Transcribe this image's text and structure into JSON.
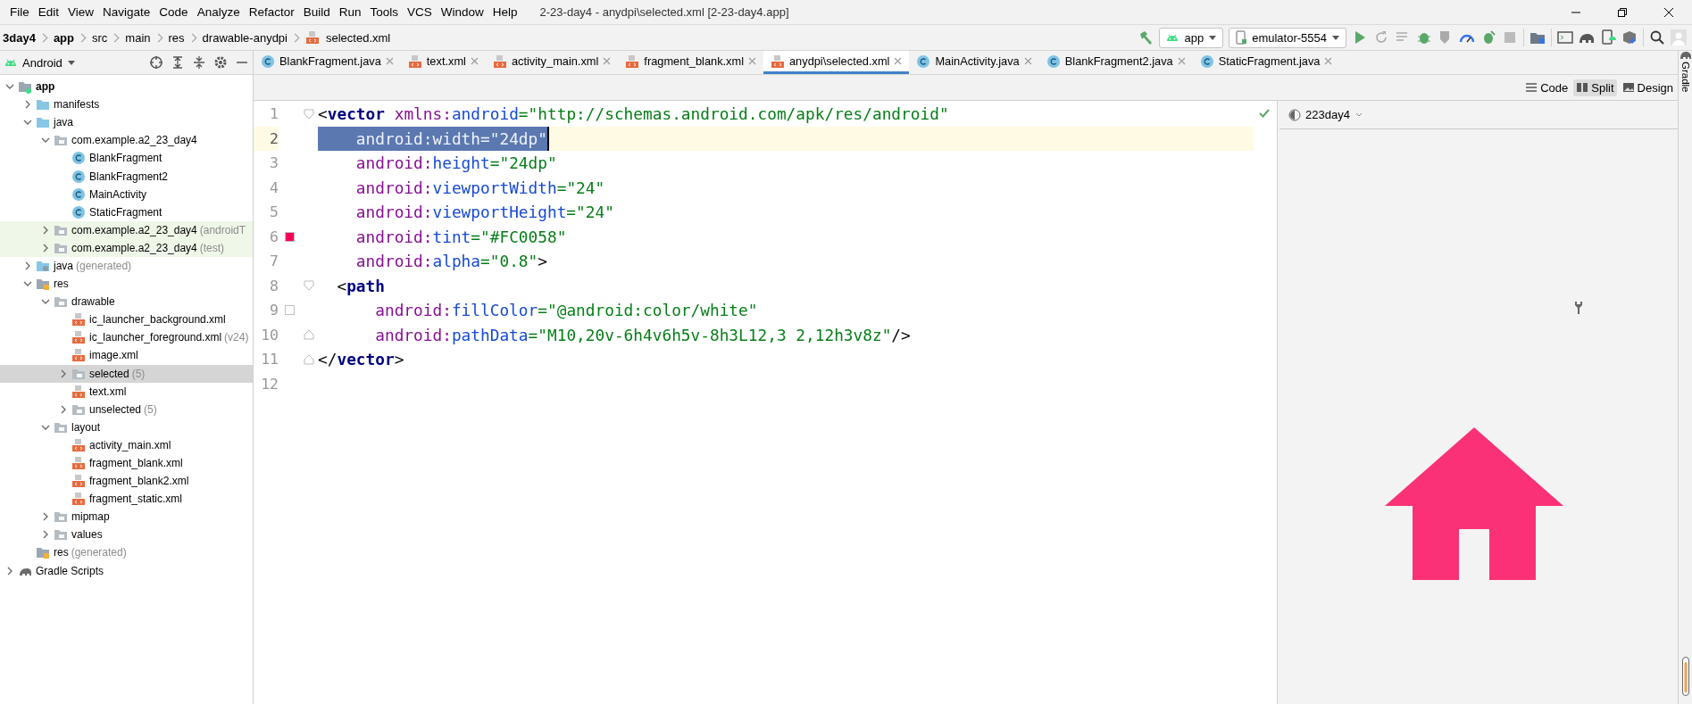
{
  "menu": [
    "File",
    "Edit",
    "View",
    "Navigate",
    "Code",
    "Analyze",
    "Refactor",
    "Build",
    "Run",
    "Tools",
    "VCS",
    "Window",
    "Help"
  ],
  "window": {
    "title": "2-23-day4 - anydpi\\selected.xml [2-23-day4.app]"
  },
  "breadcrumbs": [
    {
      "label": "3day4",
      "kind": "module"
    },
    {
      "label": "app",
      "kind": "module"
    },
    {
      "label": "src",
      "kind": "folder"
    },
    {
      "label": "main",
      "kind": "folder"
    },
    {
      "label": "res",
      "kind": "folder"
    },
    {
      "label": "drawable-anydpi",
      "kind": "folder"
    },
    {
      "label": "selected.xml",
      "kind": "file"
    }
  ],
  "toolbar": {
    "run_config": "app",
    "device": "emulator-5554"
  },
  "project_panel": {
    "view": "Android"
  },
  "tree": [
    {
      "label": "app",
      "kind": "module",
      "expanded": true,
      "selected": false,
      "children": [
        {
          "label": "manifests",
          "kind": "source-folder",
          "expanded": false,
          "selected": false
        },
        {
          "label": "java",
          "kind": "source-folder",
          "expanded": true,
          "selected": false,
          "children": [
            {
              "label": "com.example.a2_23_day4",
              "kind": "package",
              "expanded": true,
              "selected": false,
              "children": [
                {
                  "label": "BlankFragment",
                  "kind": "class",
                  "selected": false
                },
                {
                  "label": "BlankFragment2",
                  "kind": "class",
                  "selected": false
                },
                {
                  "label": "MainActivity",
                  "kind": "class",
                  "selected": false
                },
                {
                  "label": "StaticFragment",
                  "kind": "class",
                  "selected": false
                }
              ]
            },
            {
              "label": "com.example.a2_23_day4",
              "suffix": "(androidT",
              "kind": "package",
              "expanded": false,
              "selected": false,
              "test": true
            },
            {
              "label": "com.example.a2_23_day4",
              "suffix": "(test)",
              "kind": "package",
              "expanded": false,
              "selected": false,
              "test": true
            }
          ]
        },
        {
          "label": "java",
          "suffix": "(generated)",
          "kind": "generated-folder",
          "expanded": false,
          "selected": false
        },
        {
          "label": "res",
          "kind": "res-folder",
          "expanded": true,
          "selected": false,
          "children": [
            {
              "label": "drawable",
              "kind": "package",
              "expanded": true,
              "selected": false,
              "children": [
                {
                  "label": "ic_launcher_background.xml",
                  "kind": "xml",
                  "selected": false
                },
                {
                  "label": "ic_launcher_foreground.xml",
                  "suffix": "(v24)",
                  "kind": "xml",
                  "selected": false
                },
                {
                  "label": "image.xml",
                  "kind": "xml",
                  "selected": false
                },
                {
                  "label": "selected",
                  "suffix": "(5)",
                  "kind": "package",
                  "expanded": false,
                  "selected": true
                },
                {
                  "label": "text.xml",
                  "kind": "xml",
                  "selected": false
                },
                {
                  "label": "unselected",
                  "suffix": "(5)",
                  "kind": "package",
                  "expanded": false,
                  "selected": false
                }
              ]
            },
            {
              "label": "layout",
              "kind": "package",
              "expanded": true,
              "selected": false,
              "children": [
                {
                  "label": "activity_main.xml",
                  "kind": "xml",
                  "selected": false
                },
                {
                  "label": "fragment_blank.xml",
                  "kind": "xml",
                  "selected": false
                },
                {
                  "label": "fragment_blank2.xml",
                  "kind": "xml",
                  "selected": false
                },
                {
                  "label": "fragment_static.xml",
                  "kind": "xml",
                  "selected": false
                }
              ]
            },
            {
              "label": "mipmap",
              "kind": "package",
              "expanded": false,
              "selected": false
            },
            {
              "label": "values",
              "kind": "package",
              "expanded": false,
              "selected": false
            }
          ]
        },
        {
          "label": "res",
          "suffix": "(generated)",
          "kind": "res-folder",
          "selected": false
        }
      ]
    },
    {
      "label": "Gradle Scripts",
      "kind": "gradle",
      "expanded": false,
      "selected": false
    }
  ],
  "tabs": [
    {
      "label": "BlankFragment.java",
      "kind": "class",
      "selected": false
    },
    {
      "label": "text.xml",
      "kind": "xml",
      "selected": false
    },
    {
      "label": "activity_main.xml",
      "kind": "xml",
      "selected": false
    },
    {
      "label": "fragment_blank.xml",
      "kind": "xml",
      "selected": false
    },
    {
      "label": "anydpi\\selected.xml",
      "kind": "xml",
      "selected": true
    },
    {
      "label": "MainActivity.java",
      "kind": "class",
      "selected": false
    },
    {
      "label": "BlankFragment2.java",
      "kind": "class",
      "selected": false
    },
    {
      "label": "StaticFragment.java",
      "kind": "class",
      "selected": false
    }
  ],
  "view_modes": [
    {
      "label": "Code",
      "kind": "code",
      "selected": false
    },
    {
      "label": "Split",
      "kind": "split",
      "selected": true
    },
    {
      "label": "Design",
      "kind": "design",
      "selected": false
    }
  ],
  "code": {
    "lines": [
      {
        "number": "1",
        "fold_start": true,
        "text": "<vector xmlns:android=\"http://schemas.android.com/apk/res/android\""
      },
      {
        "number": "2",
        "current": true,
        "selected": true,
        "text": "    android:width=\"24dp\""
      },
      {
        "number": "3",
        "text": "    android:height=\"24dp\""
      },
      {
        "number": "4",
        "text": "    android:viewportWidth=\"24\""
      },
      {
        "number": "5",
        "text": "    android:viewportHeight=\"24\""
      },
      {
        "number": "6",
        "color": "#FC0058",
        "text": "    android:tint=\"#FC0058\""
      },
      {
        "number": "7",
        "text": "    android:alpha=\"0.8\">"
      },
      {
        "number": "8",
        "fold_start": true,
        "text": "  <path"
      },
      {
        "number": "9",
        "color": "#FFFFFF",
        "text": "      android:fillColor=\"@android:color/white\""
      },
      {
        "number": "10",
        "fold_end": true,
        "text": "      android:pathData=\"M10,20v-6h4v6h5v-8h3L12,3 2,12h3v8z\"/>"
      },
      {
        "number": "11",
        "fold_end": true,
        "text": "</vector>"
      },
      {
        "number": "12"
      }
    ]
  },
  "preview": {
    "theme": "223day4"
  },
  "right_strip": {
    "label": "Gradle"
  }
}
